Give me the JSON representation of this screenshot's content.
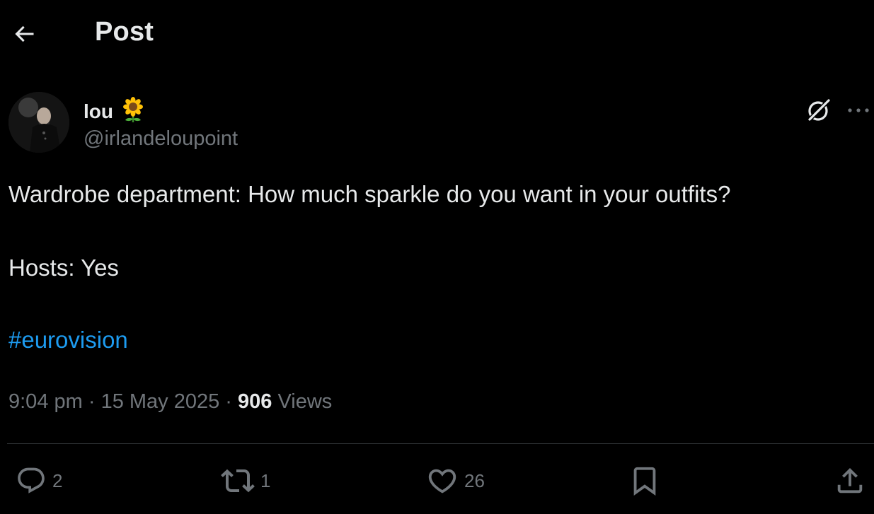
{
  "header": {
    "title": "Post",
    "back_icon": "arrow-left-icon"
  },
  "author": {
    "display_name": "lou",
    "emoji": "🌻",
    "handle": "@irlandeloupoint",
    "avatar": "avatar"
  },
  "post": {
    "line1": "Wardrobe department: How much sparkle do you want in your outfits?",
    "line2": "Hosts: Yes",
    "hashtag": "#eurovision"
  },
  "meta": {
    "time": "9:04 pm",
    "sep1": " · ",
    "date": "15 May 2025",
    "sep2": " · ",
    "views_count": "906",
    "views_label": " Views"
  },
  "actions": {
    "reply_count": "2",
    "repost_count": "1",
    "like_count": "26"
  },
  "colors": {
    "background": "#000000",
    "text": "#e7e9ea",
    "muted": "#71767b",
    "link": "#1d9bf0",
    "divider": "#2f3336"
  }
}
